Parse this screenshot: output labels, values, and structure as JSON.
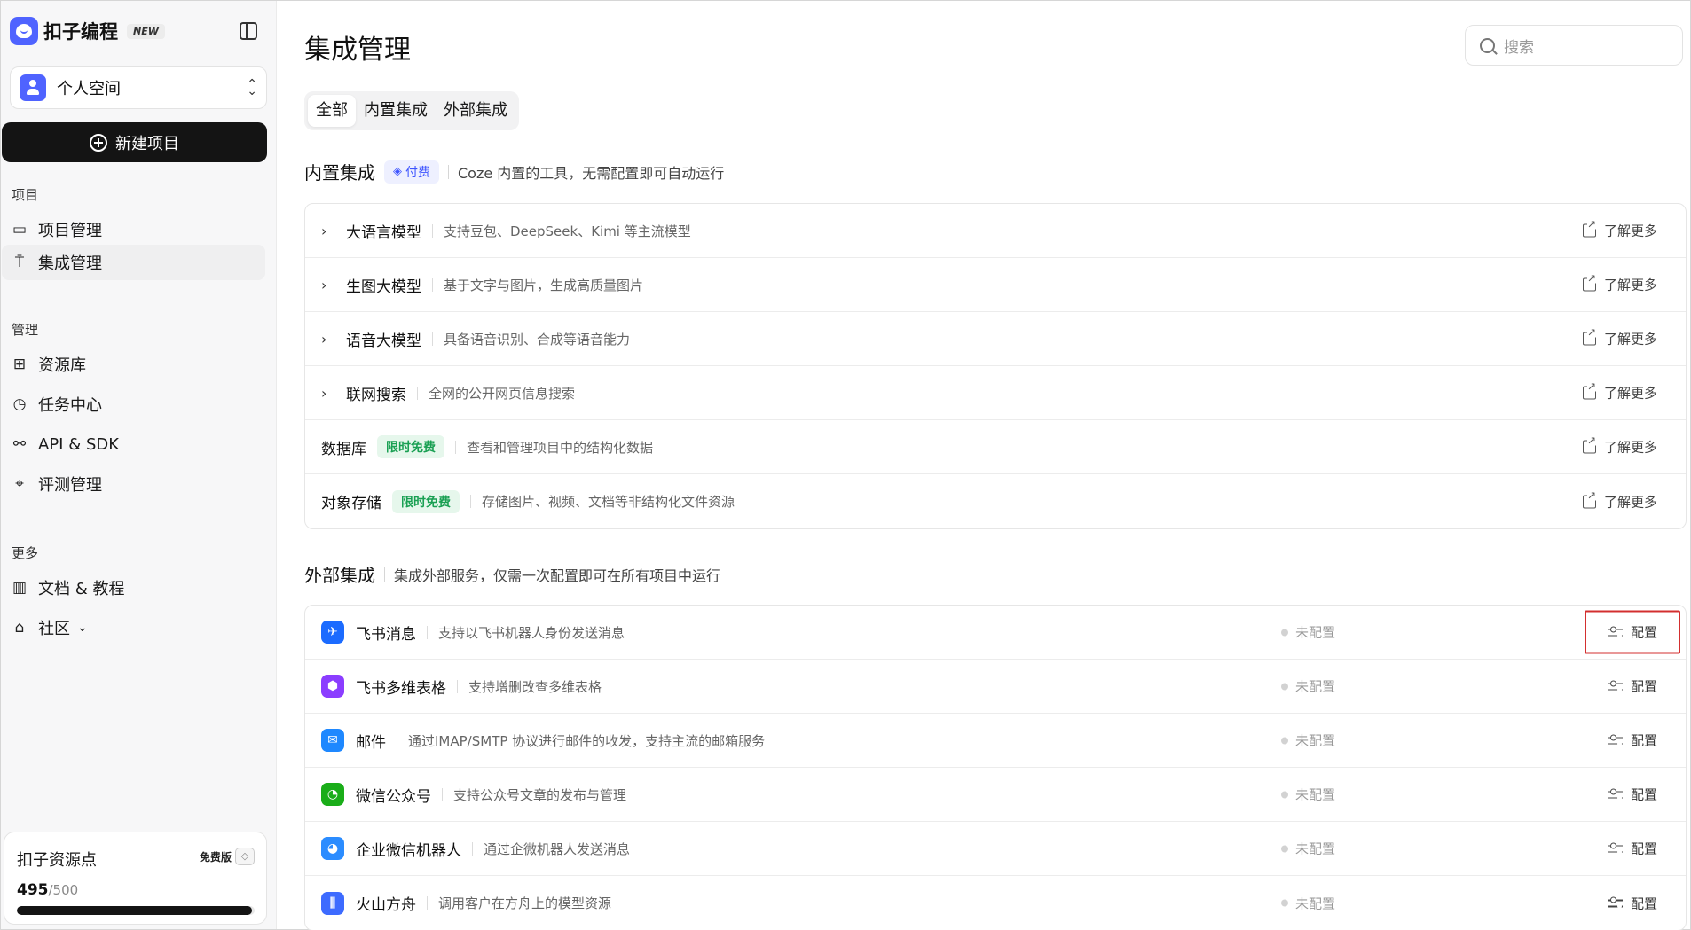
{
  "brand": {
    "name": "扣子编程",
    "tag": "NEW"
  },
  "space": {
    "name": "个人空间"
  },
  "sidebar": {
    "new_project": "新建项目",
    "sections": [
      {
        "title": "项目",
        "items": [
          {
            "label": "项目管理",
            "icon": "folder-icon"
          },
          {
            "label": "集成管理",
            "icon": "integration-icon",
            "active": true
          }
        ]
      },
      {
        "title": "管理",
        "items": [
          {
            "label": "资源库",
            "icon": "resource-library-icon"
          },
          {
            "label": "任务中心",
            "icon": "alarm-clock-icon"
          },
          {
            "label": "API & SDK",
            "icon": "api-icon"
          },
          {
            "label": "评测管理",
            "icon": "telescope-icon"
          }
        ]
      },
      {
        "title": "更多",
        "items": [
          {
            "label": "文档 & 教程",
            "icon": "map-book-icon"
          },
          {
            "label": "社区",
            "icon": "store-icon"
          }
        ]
      }
    ]
  },
  "resources": {
    "title": "扣子资源点",
    "plan": "免费版",
    "used": "495",
    "total": "/500",
    "progress": 0.99
  },
  "page": {
    "title": "集成管理"
  },
  "search": {
    "placeholder": "搜索"
  },
  "tabs": [
    "全部",
    "内置集成",
    "外部集成"
  ],
  "builtin": {
    "title": "内置集成",
    "paid_badge": "付费",
    "desc": "Coze 内置的工具，无需配置即可自动运行",
    "learn_more": "了解更多",
    "rows": [
      {
        "name": "大语言模型",
        "desc": "支持豆包、DeepSeek、Kimi 等主流模型",
        "expandable": true
      },
      {
        "name": "生图大模型",
        "desc": "基于文字与图片，生成高质量图片",
        "expandable": true
      },
      {
        "name": "语音大模型",
        "desc": "具备语音识别、合成等语音能力",
        "expandable": true
      },
      {
        "name": "联网搜索",
        "desc": "全网的公开网页信息搜索",
        "expandable": true
      },
      {
        "name": "数据库",
        "tag": "限时免费",
        "desc": "查看和管理项目中的结构化数据",
        "expandable": false
      },
      {
        "name": "对象存储",
        "tag": "限时免费",
        "desc": "存储图片、视频、文档等非结构化文件资源",
        "expandable": false
      }
    ]
  },
  "external": {
    "title": "外部集成",
    "desc": "集成外部服务，仅需一次配置即可在所有项目中运行",
    "status": "未配置",
    "config": "配置",
    "rows": [
      {
        "name": "飞书消息",
        "desc": "支持以飞书机器人身份发送消息",
        "icon": "feishu-icon",
        "color": "#1b6bff"
      },
      {
        "name": "飞书多维表格",
        "desc": "支持增删改查多维表格",
        "icon": "bitable-icon",
        "color": "#8b3dff"
      },
      {
        "name": "邮件",
        "desc": "通过IMAP/SMTP 协议进行邮件的收发，支持主流的邮箱服务",
        "icon": "mail-icon",
        "color": "#1e88ff"
      },
      {
        "name": "微信公众号",
        "desc": "支持公众号文章的发布与管理",
        "icon": "wechat-icon",
        "color": "#1aad19"
      },
      {
        "name": "企业微信机器人",
        "desc": "通过企微机器人发送消息",
        "icon": "wecom-icon",
        "color": "#2b8cff"
      },
      {
        "name": "火山方舟",
        "desc": "调用客户在方舟上的模型资源",
        "icon": "volcano-ark-icon",
        "color": "#3d6bff"
      }
    ]
  }
}
